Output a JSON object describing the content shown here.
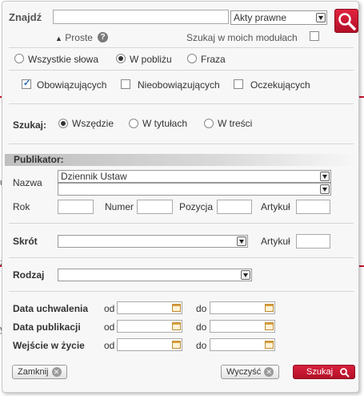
{
  "background": {
    "fragments": [
      "u",
      "z",
      "y"
    ]
  },
  "search": {
    "label": "Znajdź",
    "query_value": "",
    "scope_select": "Akty prawne",
    "mode_link": "Proste",
    "help_symbol": "?",
    "my_modules_label": "Szukaj w moich modułach"
  },
  "match_options": {
    "all_words": "Wszystkie słowa",
    "nearby": "W pobliżu",
    "phrase": "Fraza"
  },
  "status_filters": {
    "in_force": "Obowiązujących",
    "not_in_force": "Nieobowiązujących",
    "pending": "Oczekujących"
  },
  "search_in": {
    "label": "Szukaj:",
    "everywhere": "Wszędzie",
    "titles": "W tytułach",
    "content": "W treści"
  },
  "publisher": {
    "header": "Publikator:",
    "name_label": "Nazwa",
    "name_value": "Dziennik Ustaw",
    "name_value_2": "",
    "year_label": "Rok",
    "number_label": "Numer",
    "position_label": "Pozycja",
    "article_label": "Artykuł"
  },
  "abbrev": {
    "label": "Skrót",
    "article_label": "Artykuł"
  },
  "kind": {
    "label": "Rodzaj"
  },
  "dates": {
    "from_label": "od",
    "to_label": "do",
    "rows": [
      {
        "label": "Data uchwalenia"
      },
      {
        "label": "Data publikacji"
      },
      {
        "label": "Wejście w życie"
      }
    ]
  },
  "buttons": {
    "close": "Zamknij",
    "clear": "Wyczyść",
    "search": "Szukaj",
    "x_symbol": "✕"
  },
  "colors": {
    "accent": "#c8102e",
    "panel_bg": "#f7f7f7"
  }
}
